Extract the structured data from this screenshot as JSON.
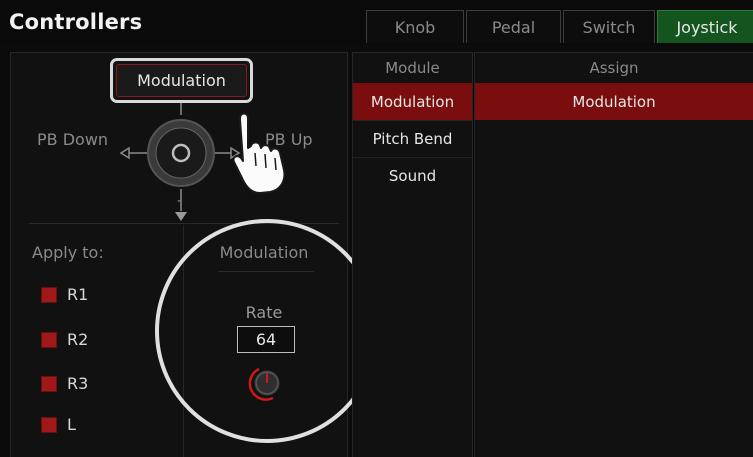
{
  "header": {
    "title": "Controllers",
    "tabs": [
      {
        "label": "Knob",
        "active": false
      },
      {
        "label": "Pedal",
        "active": false
      },
      {
        "label": "Switch",
        "active": false
      },
      {
        "label": "Joystick",
        "active": true
      }
    ]
  },
  "joystick": {
    "up_assignment": "Modulation",
    "left_label": "PB Down",
    "right_label": "PB Up",
    "down_label": "-"
  },
  "apply_to": {
    "label": "Apply to:",
    "items": [
      "R1",
      "R2",
      "R3",
      "L"
    ]
  },
  "modulation": {
    "section_label": "Modulation",
    "rate_label": "Rate",
    "rate_value": "64"
  },
  "module_list": {
    "header": "Module",
    "items": [
      "Modulation",
      "Pitch Bend",
      "Sound"
    ],
    "selected": "Modulation"
  },
  "assign_list": {
    "header": "Assign",
    "items": [
      "Modulation"
    ]
  },
  "colors": {
    "accent_red": "#7a0e0e",
    "active_tab_green": "#14551f",
    "checkbox_red": "#a11818"
  },
  "icons": {
    "joystick": "joystick-icon",
    "hand": "pointing-hand-icon",
    "knob": "rotary-knob-icon"
  }
}
